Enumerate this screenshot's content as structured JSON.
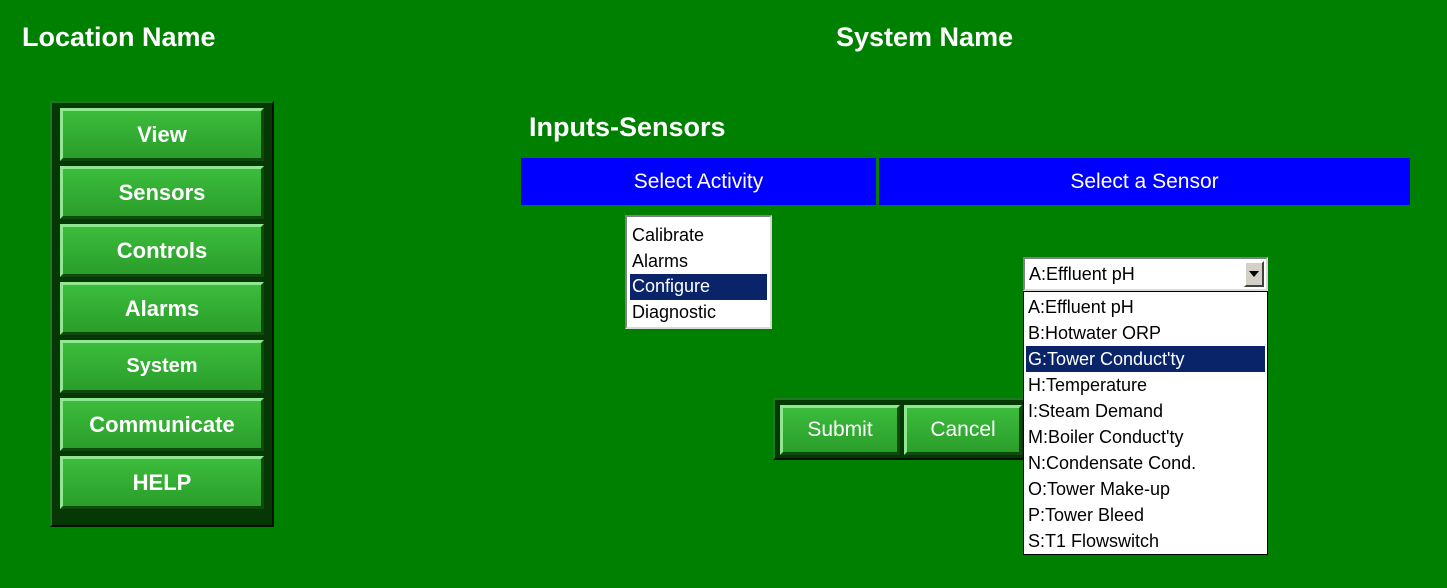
{
  "header": {
    "location": "Location Name",
    "system": "System Name"
  },
  "nav": {
    "items": [
      {
        "label": "View"
      },
      {
        "label": "Sensors"
      },
      {
        "label": "Controls"
      },
      {
        "label": "Alarms"
      },
      {
        "label": "System"
      },
      {
        "label": "Communicate"
      },
      {
        "label": "HELP"
      }
    ]
  },
  "page_title": "Inputs-Sensors",
  "table": {
    "col_activity": "Select Activity",
    "col_sensor": "Select a Sensor"
  },
  "activity": {
    "options": [
      "Calibrate",
      "Alarms",
      "Configure",
      "Diagnostic"
    ],
    "selected": "Configure"
  },
  "buttons": {
    "submit": "Submit",
    "cancel": "Cancel"
  },
  "sensor": {
    "selected_value": "A:Effluent pH",
    "highlighted": "G:Tower Conduct'ty",
    "options": [
      "A:Effluent pH",
      "B:Hotwater ORP",
      "G:Tower Conduct'ty",
      "H:Temperature",
      "I:Steam Demand",
      "M:Boiler Conduct'ty",
      "N:Condensate Cond.",
      "O:Tower Make-up",
      "P:Tower Bleed",
      "S:T1 Flowswitch"
    ]
  },
  "colors": {
    "background": "#008000",
    "header_bar": "#0000ff",
    "selection": "#0a246a",
    "button": "#2fa82f"
  }
}
